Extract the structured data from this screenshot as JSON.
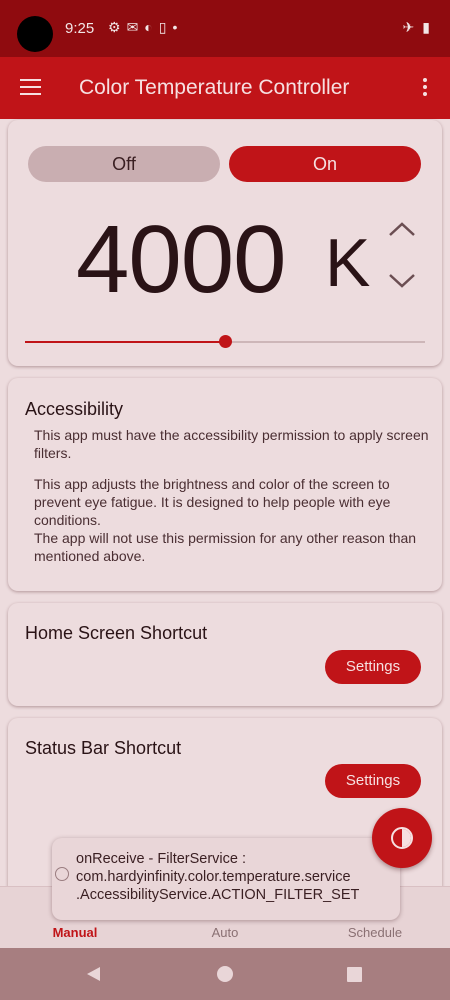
{
  "status_bar": {
    "time": "9:25",
    "left_icons": [
      "gear-icon",
      "gmail-icon",
      "contrast-icon",
      "sim-icon",
      "dot-icon"
    ],
    "right_icons": [
      "airplane-icon",
      "battery-icon"
    ]
  },
  "app_bar": {
    "title": "Color Temperature Controller",
    "menu_icon": "hamburger-icon",
    "overflow_icon": "more-vert-icon"
  },
  "control_card": {
    "off_label": "Off",
    "on_label": "On",
    "state": "On",
    "temperature_value": "4000",
    "temperature_unit": "K",
    "slider_fraction": 0.5
  },
  "accessibility_card": {
    "title": "Accessibility",
    "para1": "This app must have the accessibility permission to apply screen filters.",
    "para2": "This app adjusts the brightness and color of the screen to prevent eye fatigue. It is designed to help people with eye conditions.",
    "para3": "The app will not use this permission for any other reason than mentioned above."
  },
  "home_shortcut_card": {
    "title": "Home Screen Shortcut",
    "button_label": "Settings"
  },
  "status_shortcut_card": {
    "title": "Status Bar Shortcut",
    "button_label": "Settings"
  },
  "toast": {
    "line1": "onReceive - FilterService :",
    "line2": "com.hardyinfinity.color.temperature.service",
    "line3": ".AccessibilityService.ACTION_FILTER_SET"
  },
  "bottom_nav": {
    "items": [
      {
        "label": "Manual",
        "icon": "gear-icon",
        "active": true
      },
      {
        "label": "Auto",
        "icon": "gear-icon",
        "active": false
      },
      {
        "label": "Schedule",
        "icon": "clock-icon",
        "active": false
      }
    ]
  },
  "colors": {
    "accent": "#c01418",
    "status_bar": "#8f0b0f",
    "background": "#eddcde"
  }
}
